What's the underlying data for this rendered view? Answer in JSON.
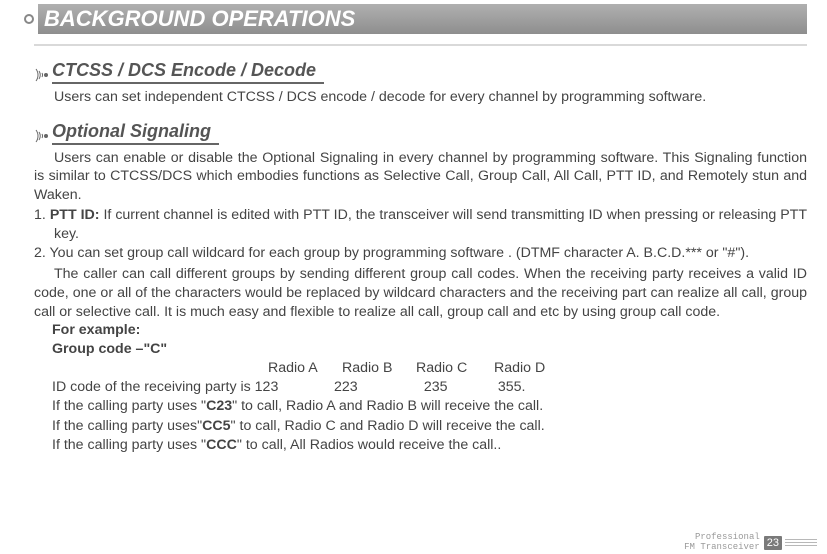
{
  "header": {
    "title": "BACKGROUND OPERATIONS"
  },
  "section1": {
    "title": "CTCSS / DCS Encode / Decode",
    "p1": "Users can set independent CTCSS / DCS encode / decode for every channel by programming software."
  },
  "section2": {
    "title": "Optional Signaling",
    "p1": "Users can enable or disable the Optional Signaling in every channel by programming software. This Signaling function is similar to CTCSS/DCS which embodies functions as Selective Call, Group Call, All Call, PTT ID, and Remotely stun and Waken.",
    "li1_num": "1.  ",
    "li1_bold": "PTT ID:",
    "li1_rest": " If current channel is edited with PTT ID, the transceiver will send transmitting ID when pressing or releasing PTT key.",
    "li2": "2. You can set group call wildcard for each group by programming software . (DTMF character A. B.C.D.*** or \"#\").",
    "p2": "The caller can call different groups by sending different group call codes. When the receiving party receives a valid ID code, one or all of the characters would be replaced by wildcard characters and the receiving part can realize all call, group call or selective call. It is much easy and flexible to realize all call, group call and etc  by using group call code.",
    "example_label": "For example:",
    "group_code_label": "Group code –\"C\"",
    "radio_a": "Radio A",
    "radio_b": "Radio B",
    "radio_c": "Radio C",
    "radio_d": "Radio D",
    "idline_lead": "ID code of the receiving party is 123",
    "id_b": "223",
    "id_c": "235",
    "id_d": "355.",
    "call1_a": "If the calling party uses \"",
    "call1_code": "C23",
    "call1_b": "\" to call, Radio A and Radio B will receive the call.",
    "call2_a": "If the calling party uses\"",
    "call2_code": "CC5",
    "call2_b": "\" to call, Radio C and Radio D will receive the call.",
    "call3_a": "If the calling party uses \"",
    "call3_code": "CCC",
    "call3_b": "\" to call, All Radios would receive the call..",
    "footer_line1": "Professional",
    "footer_line2": "FM Transceiver",
    "page_number": "23"
  }
}
